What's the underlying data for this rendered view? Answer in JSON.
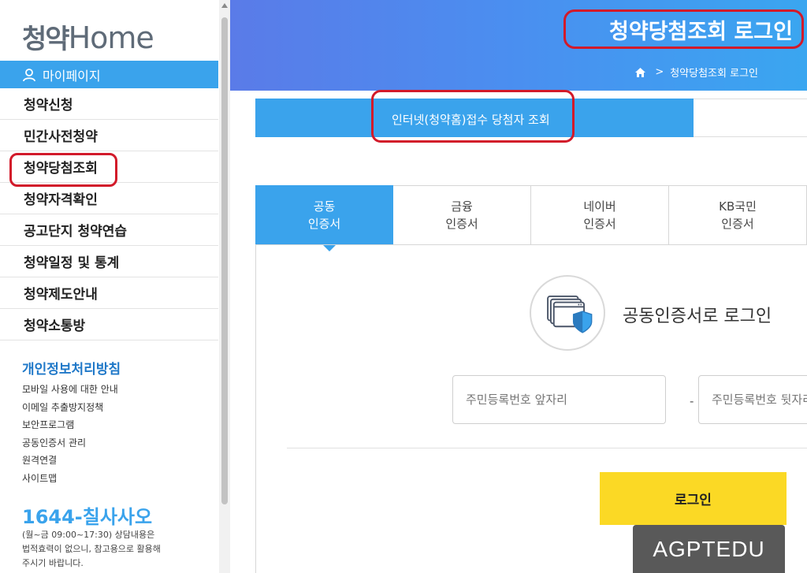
{
  "sidebar": {
    "logo": {
      "korean": "청약",
      "english": "Home"
    },
    "mypage_label": "마이페이지",
    "menu": [
      {
        "label": "청약신청"
      },
      {
        "label": "민간사전청약"
      },
      {
        "label": "청약당첨조회"
      },
      {
        "label": "청약자격확인"
      },
      {
        "label": "공고단지 청약연습"
      },
      {
        "label": "청약일정 및 통계"
      },
      {
        "label": "청약제도안내"
      },
      {
        "label": "청약소통방"
      }
    ],
    "privacy_title": "개인정보처리방침",
    "sub_links": [
      {
        "label": "모바일 사용에 대한 안내"
      },
      {
        "label": "이메일 추출방지정책"
      },
      {
        "label": "보안프로그램"
      },
      {
        "label": "공동인증서 관리"
      },
      {
        "label": "원격연결"
      },
      {
        "label": "사이트맵"
      }
    ],
    "phone": "1644-칠사사오",
    "phone_note": [
      "(월~금 09:00~17:30) 상담내용은",
      "법적효력이 없으니, 참고용으로 활용해",
      "주시기 바랍니다."
    ]
  },
  "header": {
    "title": "청약당첨조회 로그인",
    "breadcrumb": [
      "청약당첨조회 로그인"
    ]
  },
  "tabs": {
    "active_label": "인터넷(청약홈)접수 당첨자 조회"
  },
  "cert_tabs": [
    {
      "line1": "공동",
      "line2": "인증서",
      "active": true
    },
    {
      "line1": "금융",
      "line2": "인증서",
      "active": false
    },
    {
      "line1": "네이버",
      "line2": "인증서",
      "active": false
    },
    {
      "line1": "KB국민",
      "line2": "인증서",
      "active": false
    }
  ],
  "login": {
    "heading": "공동인증서로 로그인",
    "front_placeholder": "주민등록번호 앞자리",
    "back_placeholder": "주민등록번호 뒷자리",
    "separator": "-",
    "button_label": "로그인"
  },
  "watermark": "AGPTEDU",
  "colors": {
    "accent": "#3aa3ec",
    "highlight": "#d21a2a",
    "button": "#fbd925"
  }
}
